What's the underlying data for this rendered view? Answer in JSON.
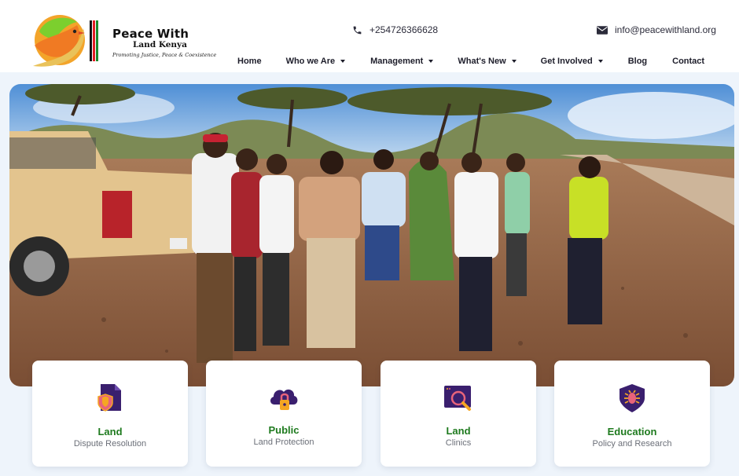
{
  "brand": {
    "name": "Peace With",
    "name_line2": "Land Kenya",
    "tagline": "Promoting Justice, Peace & Coexistence"
  },
  "contact": {
    "phone": "+254726366628",
    "email": "info@peacewithland.org",
    "phone_icon": "phone-icon",
    "email_icon": "envelope-icon"
  },
  "nav": [
    {
      "label": "Home",
      "dropdown": false
    },
    {
      "label": "Who we Are",
      "dropdown": true
    },
    {
      "label": "Management",
      "dropdown": true
    },
    {
      "label": "What's New",
      "dropdown": true
    },
    {
      "label": "Get Involved",
      "dropdown": true
    },
    {
      "label": "Blog",
      "dropdown": false
    },
    {
      "label": "Contact",
      "dropdown": false
    }
  ],
  "cards": [
    {
      "title": "Land",
      "subtitle": "Dispute Resolution",
      "icon": "shield-document-icon"
    },
    {
      "title": "Public",
      "subtitle": "Land Protection",
      "icon": "cloud-lock-icon"
    },
    {
      "title": "Land",
      "subtitle": "Clinics",
      "icon": "browser-search-icon"
    },
    {
      "title": "Education",
      "subtitle": "Policy and Research",
      "icon": "shield-bug-icon"
    }
  ],
  "colors": {
    "accent_green": "#1e7a1e",
    "icon_purple": "#3a1f6e",
    "icon_pink": "#e8637a",
    "icon_orange": "#f5a623"
  }
}
